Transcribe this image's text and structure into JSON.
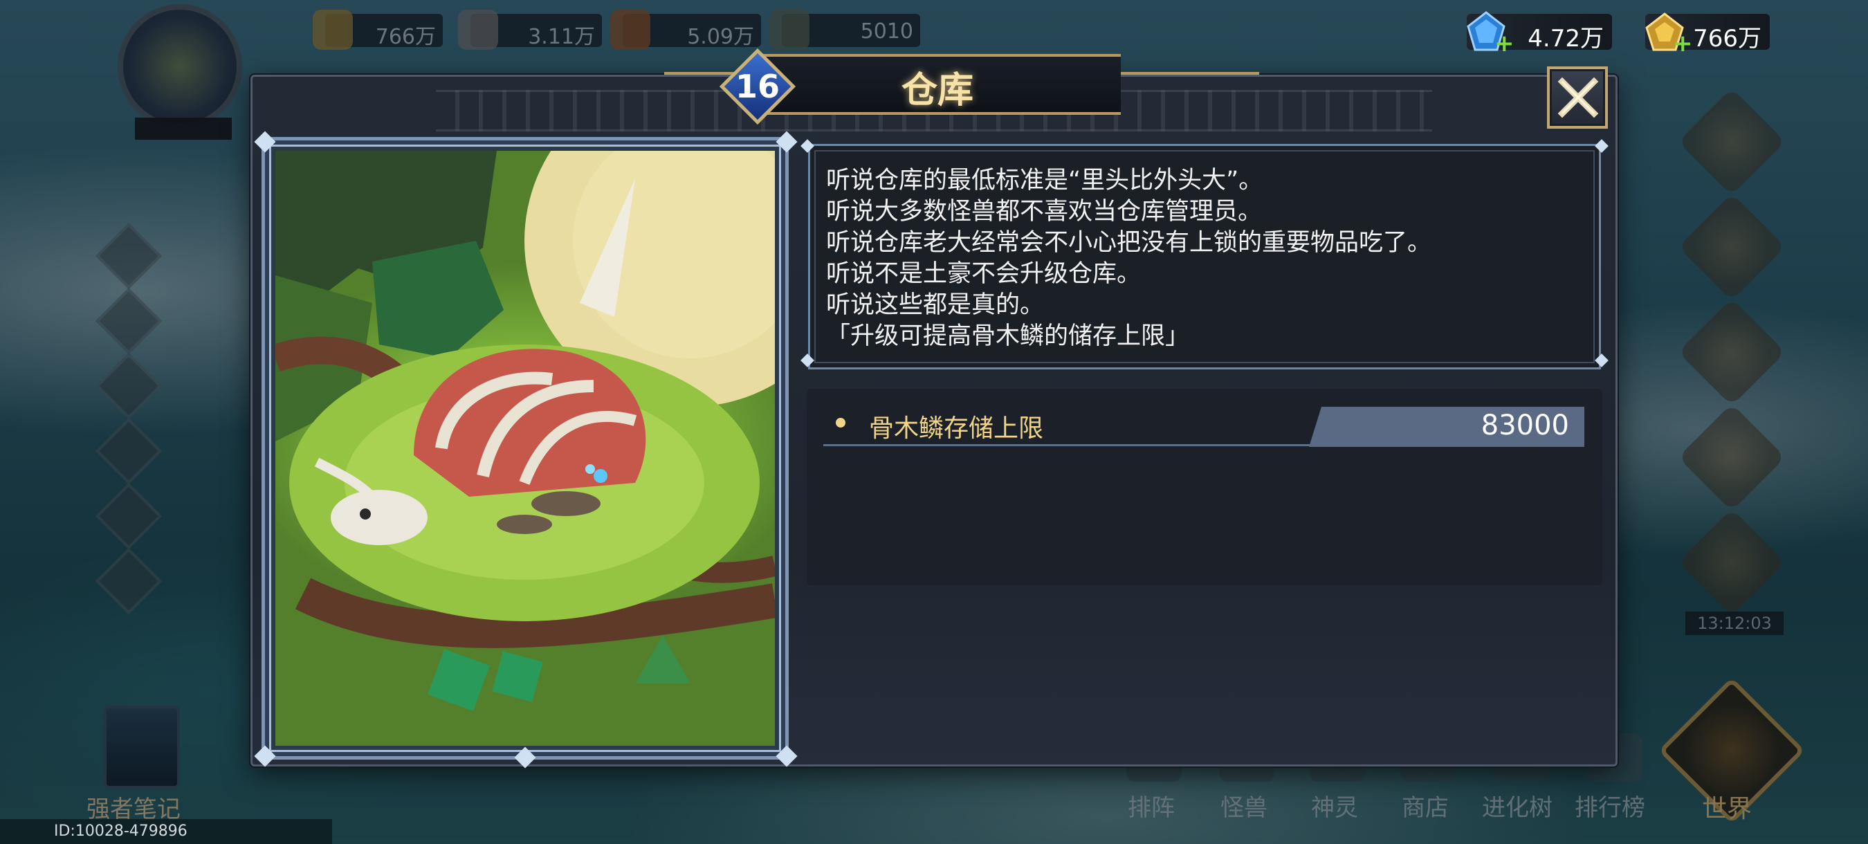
{
  "title": "仓库",
  "level": "16",
  "currency": {
    "diamond_value": "4.72万",
    "gold_value": "766万",
    "plus_symbol": "+"
  },
  "resources_background": [
    "766万",
    "3.11万",
    "5.09万",
    "5010"
  ],
  "description_lines": [
    "听说仓库的最低标准是“里头比外头大”。",
    "听说大多数怪兽都不喜欢当仓库管理员。",
    "听说仓库老大经常会不小心把没有上锁的重要物品吃了。",
    "听说不是土豪不会升级仓库。",
    "听说这些都是真的。",
    "「升级可提高骨木鳞的储存上限」"
  ],
  "stat": {
    "label": "骨木鳞存储上限",
    "value": "83000"
  },
  "bottom_nav": [
    "排阵",
    "怪兽",
    "神灵",
    "商店",
    "进化树",
    "排行榜",
    "世界"
  ],
  "notes_label": "强者笔记",
  "timer": "13:12:03",
  "player_id": "ID:10028-479896",
  "colors": {
    "accent_gold": "#c2a870",
    "stat_label": "#f1d489",
    "frame_blue": "#7f95b4",
    "level_badge": "#2f5bc0",
    "plus_green": "#7ddc42"
  },
  "icons": {
    "close": "close-x-icon",
    "diamond": "diamond-gem-icon",
    "gold": "gold-ingot-icon",
    "stat_bullet": "bullet-dot-icon"
  }
}
